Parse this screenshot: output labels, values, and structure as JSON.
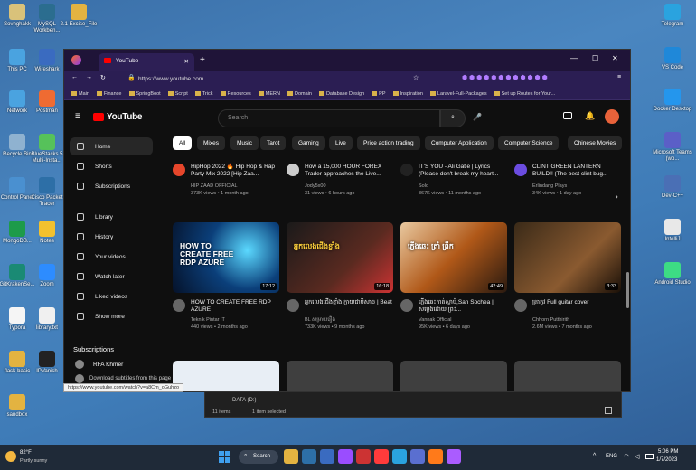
{
  "desktop": {
    "left": [
      {
        "label": "Sovnghakk",
        "color": "#d9c27a"
      },
      {
        "label": "MySQL Workben...",
        "color": "#2b6d8f"
      },
      {
        "label": "2.1 Excise_File",
        "color": "#e3b341"
      },
      {
        "label": "This PC",
        "color": "#4aa3e0"
      },
      {
        "label": "Wireshark",
        "color": "#3a6bc0"
      },
      {
        "label": "Network",
        "color": "#4aa3e0"
      },
      {
        "label": "Postman",
        "color": "#ef6b32"
      },
      {
        "label": "Recycle Bin",
        "color": "#8fb2d0"
      },
      {
        "label": "BlueStacks 5 Multi-Insta...",
        "color": "#56c25a"
      },
      {
        "label": "Control Panel",
        "color": "#4a90d0"
      },
      {
        "label": "Cisco Packet Tracer",
        "color": "#2d6fa7"
      },
      {
        "label": "MongoDB...",
        "color": "#1d9b4a"
      },
      {
        "label": "Notes",
        "color": "#f2c12e"
      },
      {
        "label": "GitKrakenSe...",
        "color": "#1a8a74"
      },
      {
        "label": "Zoom",
        "color": "#2d8cff"
      },
      {
        "label": "Typora",
        "color": "#f5f5f5"
      },
      {
        "label": "library.txt",
        "color": "#f0f0f0"
      },
      {
        "label": "flask-basic",
        "color": "#e3b341"
      },
      {
        "label": "IPVanish",
        "color": "#222"
      },
      {
        "label": "sandbox",
        "color": "#e3b341"
      }
    ],
    "right": [
      {
        "label": "Telegram",
        "color": "#2aa3df"
      },
      {
        "label": "VS Code",
        "color": "#1f88d9"
      },
      {
        "label": "Docker Desktop",
        "color": "#2496ed"
      },
      {
        "label": "Microsoft Teams (wo...",
        "color": "#5b5fc7"
      },
      {
        "label": "Dev-C++",
        "color": "#4a6fb5"
      },
      {
        "label": "IntelliJ",
        "color": "#e8e8e8"
      },
      {
        "label": "Android Studio",
        "color": "#3ddc84"
      }
    ]
  },
  "browser": {
    "tab_title": "YouTube",
    "new_tab": "+",
    "url": "https://www.youtube.com",
    "bookmarks": [
      "Main",
      "Finance",
      "SpringBoot",
      "Script",
      "Trick",
      "Resources",
      "MERN",
      "Domain",
      "Database Design",
      "PP",
      "Inspiration",
      "Laravel-Full-Packages",
      "Set up Routes for Your..."
    ],
    "status_url": "https://www.youtube.com/watch?v=a8Cm_oGuhzo"
  },
  "youtube": {
    "logo": "YouTube",
    "search_placeholder": "Search",
    "sidebar": [
      "Home",
      "Shorts",
      "Subscriptions",
      "Library",
      "History",
      "Your videos",
      "Watch later",
      "Liked videos",
      "Show more"
    ],
    "subs_heading": "Subscriptions",
    "subs": [
      "RFA Khmer",
      "Download subtitles from this page"
    ],
    "chips": [
      "All",
      "Mixes",
      "Music",
      "Tarot",
      "Gaming",
      "Live",
      "Price action trading",
      "Computer Application",
      "Computer Science",
      "Chinese Movies"
    ],
    "row1": [
      {
        "title": "HipHop 2022 🔥 Hip Hop & Rap Party Mix 2022 [Hip Zaa...",
        "channel": "HIP ZAAD OFFICIAL",
        "meta": "373K views • 1 month ago"
      },
      {
        "title": "How a 15,000 HOUR FOREX Trader approaches the Live...",
        "channel": "Jody5x00",
        "meta": "31 views • 6 hours ago"
      },
      {
        "title": "IT'S YOU - Ali Gatie | Lyrics (Please don't break my heart...",
        "channel": "Solo",
        "meta": "367K views • 11 months ago"
      },
      {
        "title": "CLINT GREEN LANTERN BUILD!! (The best clint bug...",
        "channel": "Erlindang Plays",
        "meta": "34K views • 1 day ago"
      }
    ],
    "row2": [
      {
        "title": "HOW TO CREATE FREE RDP AZURE",
        "channel": "Teknik Pintar IT",
        "meta": "440 views • 2 months ago",
        "duration": "17:12",
        "thumb_text": "HOW TO CREATE FREE RDP AZURE"
      },
      {
        "title": "អ្នកលេងជើងខ្លាំង ក្លាយជាបិសាច | Beat",
        "channel": "BL សម្រាយរឿង",
        "meta": "733K views • 9 months ago",
        "duration": "16:18",
        "thumb_text": "អ្នកលេងជើងខ្លាំង"
      },
      {
        "title": "ភ្លើងឆេះកាត់ស្លាបំ,San Sochea | សម្លេងដោយ ព្រះ...",
        "channel": "Vannak Official",
        "meta": "95K views • 6 days ago",
        "duration": "42:49",
        "thumb_text": "ភ្លើងឆេះ ត្រាំ ព្រឹក"
      },
      {
        "title": "ត្រាតូវ Full guitar cover",
        "channel": "Chhorn Putthirith",
        "meta": "2.6M views • 7 months ago",
        "duration": "3:33",
        "thumb_text": ""
      }
    ]
  },
  "explorer": {
    "drive": "DATA (D:)",
    "items": "11 items",
    "selected": "1 item selected"
  },
  "taskbar": {
    "temp": "82°F",
    "weather": "Partly sunny",
    "search": "Search",
    "lang": "ENG",
    "time": "5:06 PM",
    "date": "1/7/2023"
  }
}
